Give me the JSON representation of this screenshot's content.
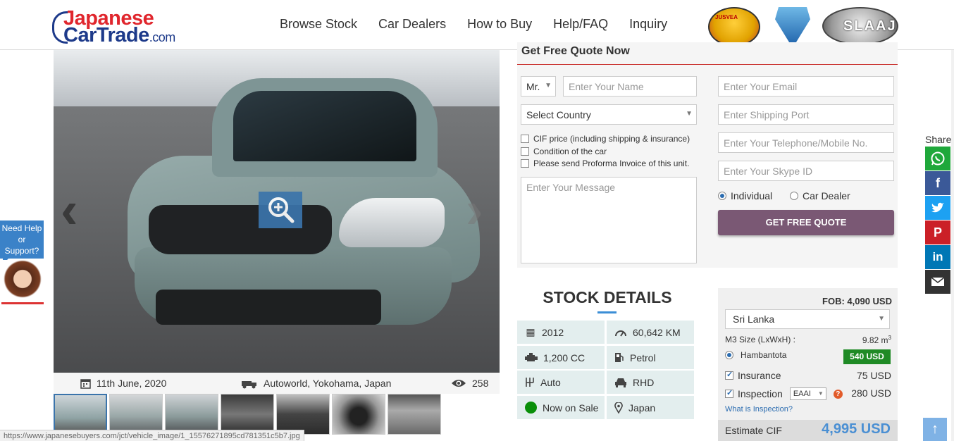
{
  "header": {
    "logo_line1": "Japanese",
    "logo_line2": "CarTrade",
    "logo_suffix": ".com",
    "nav": [
      "Browse Stock",
      "Car Dealers",
      "How to Buy",
      "Help/FAQ",
      "Inquiry"
    ],
    "badge1_text": "JUSVEA",
    "badge3_text": "SLAAJ"
  },
  "gallery": {
    "date": "11th June, 2020",
    "location": "Autoworld, Yokohama, Japan",
    "views": "258",
    "thumb_count": 7
  },
  "status_url": "https://www.japanesebuyers.com/jct/vehicle_image/1_15576271895cd781351c5b7.jpg",
  "quote": {
    "title": "Get Free Quote Now",
    "salutation": "Mr.",
    "name_placeholder": "Enter Your Name",
    "country_placeholder": "Select Country",
    "email_placeholder": "Enter Your Email",
    "port_placeholder": "Enter Shipping Port",
    "phone_placeholder": "Enter Your Telephone/Mobile No.",
    "skype_placeholder": "Enter Your Skype ID",
    "message_placeholder": "Enter Your Message",
    "checkboxes": [
      "CIF price (including shipping & insurance)",
      "Condition of the car",
      "Please send Proforma Invoice of this unit."
    ],
    "radio_individual": "Individual",
    "radio_dealer": "Car Dealer",
    "submit_label": "GET FREE QUOTE"
  },
  "stock": {
    "title": "STOCK DETAILS",
    "year": "2012",
    "mileage": "60,642 KM",
    "engine": "1,200 CC",
    "fuel": "Petrol",
    "transmission": "Auto",
    "steering": "RHD",
    "status": "Now on Sale",
    "location": "Japan"
  },
  "price": {
    "fob": "FOB: 4,090 USD",
    "country": "Sri Lanka",
    "m3_label": "M3 Size (LxWxH) :",
    "m3_value": "9.82 m",
    "m3_sup": "3",
    "port": "Hambantota",
    "port_price": "540 USD",
    "insurance_label": "Insurance",
    "insurance_value": "75 USD",
    "inspection_label": "Inspection",
    "inspection_agency": "EAAI",
    "inspection_value": "280 USD",
    "what_link": "What is Inspection?",
    "estimate_label": "Estimate CIF",
    "estimate_value": "4,995 USD"
  },
  "share": {
    "label": "Share",
    "colors": {
      "whatsapp": "#1fa83b",
      "facebook": "#3b5998",
      "twitter": "#1da1f2",
      "pinterest": "#cb2027",
      "linkedin": "#0077b5",
      "email": "#333333"
    }
  },
  "help": {
    "line1": "Need Help",
    "line2": "or",
    "line3": "Support?"
  },
  "colors": {
    "accent_blue": "#3b74ab",
    "quote_button": "#7a5874",
    "port_price_bg": "#1f8a25",
    "estimate_value": "#4a8fd3"
  }
}
